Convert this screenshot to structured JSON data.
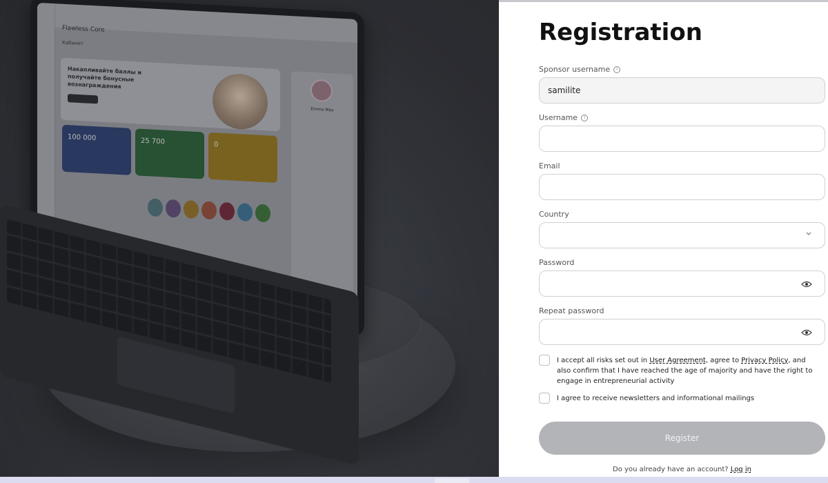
{
  "hero": {
    "app_brand": "Flawless Core",
    "app_cabinet": "Кабинет",
    "banner_text": "Накапливайте баллы и получайте бонусные вознаграждения",
    "card_blue_amount": "100 000",
    "card_green_amount": "25 700",
    "card_yellow_amount": "0",
    "profile_name": "Emma May"
  },
  "registration": {
    "title": "Registration",
    "sponsor_label": "Sponsor username",
    "sponsor_value": "samilite",
    "username_label": "Username",
    "username_value": "",
    "email_label": "Email",
    "email_value": "",
    "country_label": "Country",
    "country_value": "",
    "password_label": "Password",
    "password_value": "",
    "repeat_password_label": "Repeat password",
    "repeat_password_value": "",
    "agreement_text_1": "I accept all risks set out in ",
    "agreement_link_1": "User Agreement",
    "agreement_text_2": ", agree to ",
    "agreement_link_2": "Privacy Policy",
    "agreement_text_3": ", and also confirm that I have reached the age of majority and have the right to engage in entrepreneurial activity",
    "newsletter_text": "I agree to receive newsletters and informational mailings",
    "register_label": "Register",
    "login_prompt": "Do you already have an account?",
    "login_link": "Log in"
  },
  "colors": {
    "register_disabled": "#b3b4b8",
    "hero_bg": "#2f3137"
  },
  "icons": {
    "info": "info-circle-icon",
    "chevron": "chevron-down-icon",
    "eye": "eye-icon"
  }
}
